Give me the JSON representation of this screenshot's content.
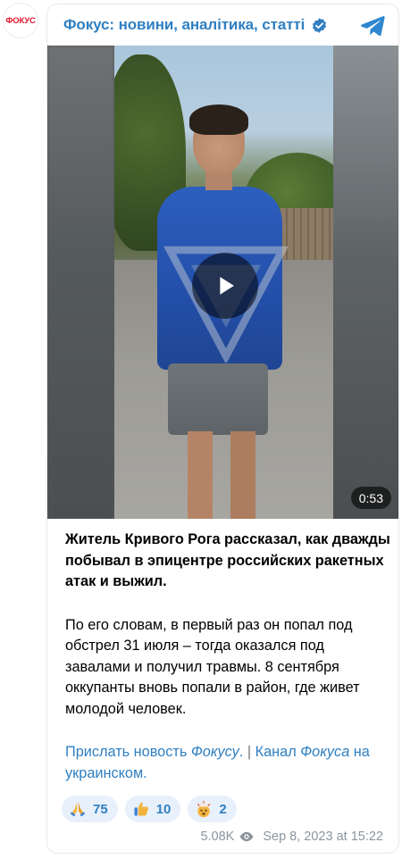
{
  "channel": {
    "avatar_text": "ФОКУС",
    "name": "Фокус: новини, аналітика, статті",
    "verified": true
  },
  "video": {
    "duration": "0:53"
  },
  "post": {
    "headline": "Житель Кривого Рога рассказал, как дважды побывал в эпицентре российских ракетных атак и выжил.",
    "body": "По его словам, в первый раз он попал под обстрел 31 июля – тогда оказался под завалами и получил травмы. 8 сентября оккупанты вновь попали в район, где живет молодой человек.",
    "links": {
      "send_news_part1": "Прислать новость",
      "send_news_part2": "Фокусу",
      "send_news_part3": ".",
      "separator": "|",
      "channel_part1": "Канал",
      "channel_part2": "Фокуса",
      "channel_part3": "на украинском",
      "channel_part4": "."
    }
  },
  "reactions": [
    {
      "icon": "praying-hands-icon",
      "count": "75"
    },
    {
      "icon": "thumbs-up-icon",
      "count": "10"
    },
    {
      "icon": "exploding-head-icon",
      "count": "2"
    }
  ],
  "meta": {
    "views": "5.08K",
    "datetime": "Sep 8, 2023 at 15:22"
  },
  "colors": {
    "accent": "#2f7fc1",
    "brand_red": "#e3162e",
    "reaction_bg": "#e8f1fb",
    "meta_gray": "#8a959e"
  }
}
